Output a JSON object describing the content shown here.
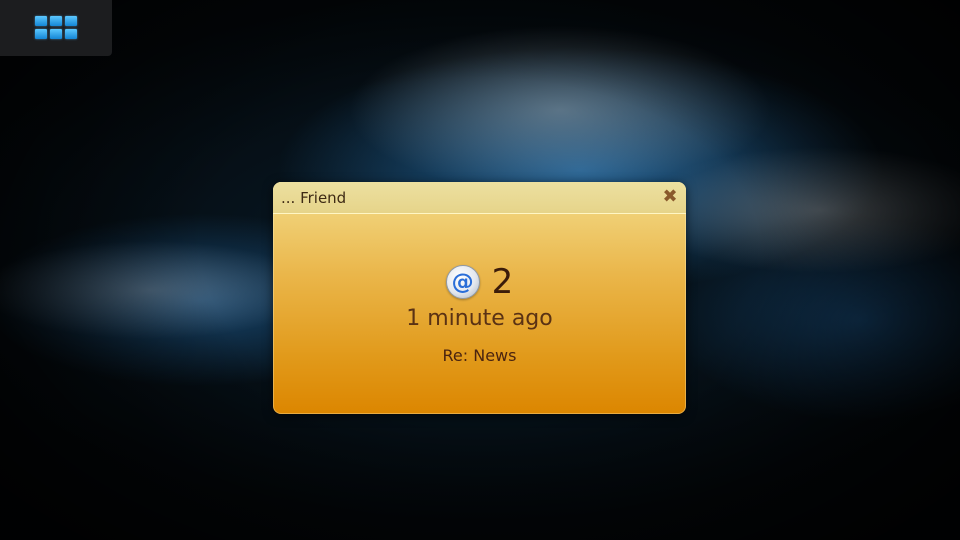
{
  "switcher": {
    "icon": "task-switcher-grid-icon",
    "color": "#2fa8ef"
  },
  "notification": {
    "title": "... Friend",
    "close_icon": "close-icon",
    "close_glyph": "✖",
    "type_icon": "email-at-icon",
    "type_glyph": "@",
    "count": "2",
    "time": "1 minute ago",
    "subject": "Re: News",
    "accent_color": "#e19a1b"
  }
}
